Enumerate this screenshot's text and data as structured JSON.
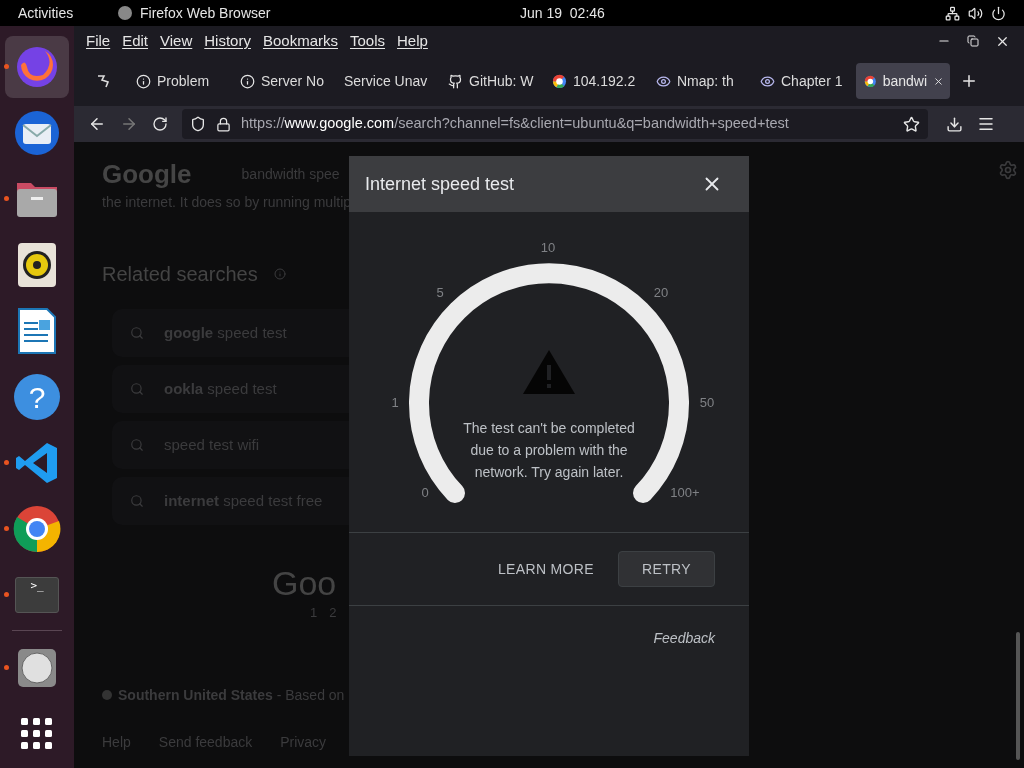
{
  "top_bar": {
    "activities": "Activities",
    "app_name": "Firefox Web Browser",
    "clock": "Jun 19  02:46"
  },
  "dock": [
    {
      "kind": "firefox",
      "running": true,
      "selected": true
    },
    {
      "kind": "mail",
      "running": false,
      "selected": false
    },
    {
      "kind": "files",
      "running": true,
      "selected": false
    },
    {
      "kind": "music",
      "running": false,
      "selected": false
    },
    {
      "kind": "writer",
      "running": false,
      "selected": false
    },
    {
      "kind": "help",
      "glyph": "?",
      "running": false,
      "selected": false
    },
    {
      "kind": "code",
      "running": true,
      "selected": false
    },
    {
      "kind": "chrome",
      "running": true,
      "selected": false
    },
    {
      "kind": "terminal",
      "glyph": ">_",
      "running": true,
      "selected": false
    },
    {
      "kind": "disc",
      "running": true,
      "selected": false
    },
    {
      "kind": "apps",
      "running": false,
      "selected": false
    }
  ],
  "menu_bar": [
    "File",
    "Edit",
    "View",
    "History",
    "Bookmarks",
    "Tools",
    "Help"
  ],
  "tabs": [
    {
      "kind": "pinned",
      "selected": false
    },
    {
      "kind": "info",
      "label": "Problem",
      "selected": false
    },
    {
      "kind": "info",
      "label": "Server No",
      "selected": false
    },
    {
      "kind": "plain",
      "label": "Service Unav",
      "selected": false
    },
    {
      "kind": "github",
      "label": "GitHub: W",
      "selected": false
    },
    {
      "kind": "google",
      "label": "104.192.2",
      "selected": false
    },
    {
      "kind": "eye",
      "label": "Nmap: th",
      "selected": false
    },
    {
      "kind": "eye",
      "label": "Chapter 1",
      "selected": false
    },
    {
      "kind": "google",
      "label": "bandwi",
      "selected": true
    }
  ],
  "address_bar": {
    "scheme": "https://",
    "host": "www.google.com",
    "path": "/search?channel=fs&client=ubuntu&q=bandwidth+speed+test"
  },
  "page": {
    "logo": "Google",
    "query": "bandwidth spee",
    "snippet": "the internet. It does so by running multip",
    "related_title": "Related searches",
    "related": [
      {
        "bold": "google",
        "rest": " speed test"
      },
      {
        "bold": "ookla",
        "rest": " speed test"
      },
      {
        "rest": "speed test wifi"
      },
      {
        "bold": "internet",
        "rest": " speed test free"
      }
    ],
    "pager_logo": "Goo",
    "pages": [
      "1",
      "2"
    ],
    "location": "Southern United States",
    "location_note": " - Based on",
    "footer": [
      "Help",
      "Send feedback",
      "Privacy"
    ]
  },
  "dialog": {
    "title": "Internet speed test",
    "scale": [
      "10",
      "5",
      "20",
      "1",
      "50",
      "0",
      "100+"
    ],
    "message": "The test can't be completed due to a problem with the network. Try again later.",
    "learn_more": "LEARN MORE",
    "retry": "RETRY",
    "feedback": "Feedback"
  }
}
